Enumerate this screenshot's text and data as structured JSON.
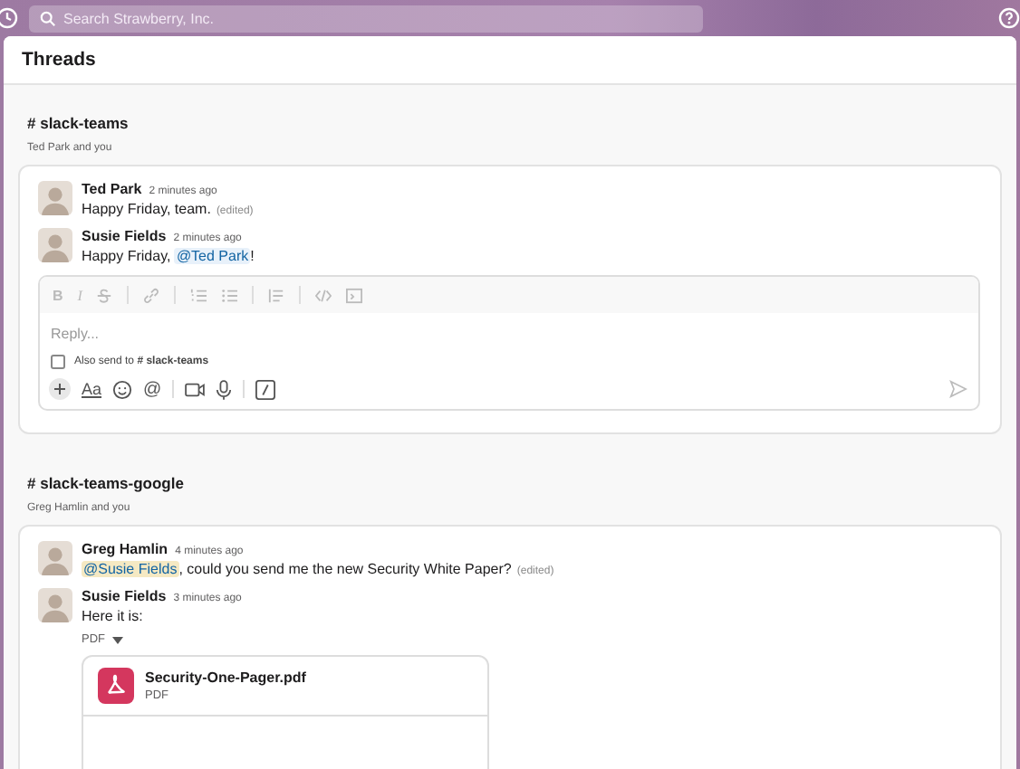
{
  "search": {
    "placeholder": "Search Strawberry, Inc."
  },
  "header": {
    "title": "Threads"
  },
  "threads": [
    {
      "channel": "slack-teams",
      "hash": "#",
      "participants": "Ted Park and you",
      "messages": [
        {
          "author": "Ted Park",
          "time": "2 minutes ago",
          "parts": [
            {
              "kind": "text",
              "text": "Happy Friday, team."
            }
          ],
          "edited": "(edited)"
        },
        {
          "author": "Susie Fields",
          "time": "2 minutes ago",
          "parts": [
            {
              "kind": "text",
              "text": "Happy Friday, "
            },
            {
              "kind": "mention",
              "text": "@Ted Park",
              "self": false
            },
            {
              "kind": "text",
              "text": "!"
            }
          ]
        }
      ],
      "composer": {
        "format_bold": "B",
        "format_italic": "I",
        "placeholder": "Reply...",
        "also_send": {
          "label": "Also send to",
          "hash": "#",
          "channel": "slack-teams",
          "checked": false
        },
        "text_format": "Aa",
        "mention": "@"
      }
    },
    {
      "channel": "slack-teams-google",
      "hash": "#",
      "participants": "Greg Hamlin and you",
      "messages": [
        {
          "author": "Greg Hamlin",
          "time": "4 minutes ago",
          "parts": [
            {
              "kind": "mention",
              "text": "@Susie Fields",
              "self": true
            },
            {
              "kind": "text",
              "text": ", could you send me the new Security White Paper?"
            }
          ],
          "edited": "(edited)"
        },
        {
          "author": "Susie Fields",
          "time": "3 minutes ago",
          "parts": [
            {
              "kind": "text",
              "text": "Here it is:"
            }
          ],
          "file": {
            "type_toggle": "PDF",
            "name": "Security-One-Pager.pdf",
            "type": "PDF"
          }
        }
      ]
    }
  ]
}
